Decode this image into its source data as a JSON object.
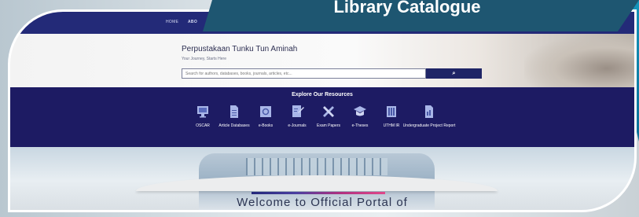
{
  "banner": {
    "title": "Library Catalogue"
  },
  "nav": {
    "items": [
      "HOME",
      "ABO"
    ]
  },
  "library": {
    "title": "Perpustakaan Tunku Tun Aminah",
    "subtitle": "Your Journey, Starts Here"
  },
  "search": {
    "placeholder": "Search for authors, databases, books, journals, articles, etc...",
    "button_icon": "search-icon",
    "button_label": "⌕"
  },
  "resources": {
    "heading": "Explore Our Resources",
    "items": [
      {
        "label": "OSCAR",
        "icon": "monitor-icon"
      },
      {
        "label": "Article Databases",
        "icon": "document-icon"
      },
      {
        "label": "e-Books",
        "icon": "book-icon"
      },
      {
        "label": "e-Journals",
        "icon": "journal-icon"
      },
      {
        "label": "Exam Papers",
        "icon": "pencil-ruler-icon"
      },
      {
        "label": "e-Theses",
        "icon": "graduation-cap-icon"
      },
      {
        "label": "UTHM IR",
        "icon": "repository-icon"
      },
      {
        "label": "Undergraduate Project Report",
        "icon": "report-icon"
      }
    ]
  },
  "welcome": {
    "text": "Welcome to Official Portal of"
  },
  "colors": {
    "nav": "#232a78",
    "resources_bg": "#1d1b63",
    "banner": "#1e5671",
    "teal_accent": "#19a2c7"
  }
}
